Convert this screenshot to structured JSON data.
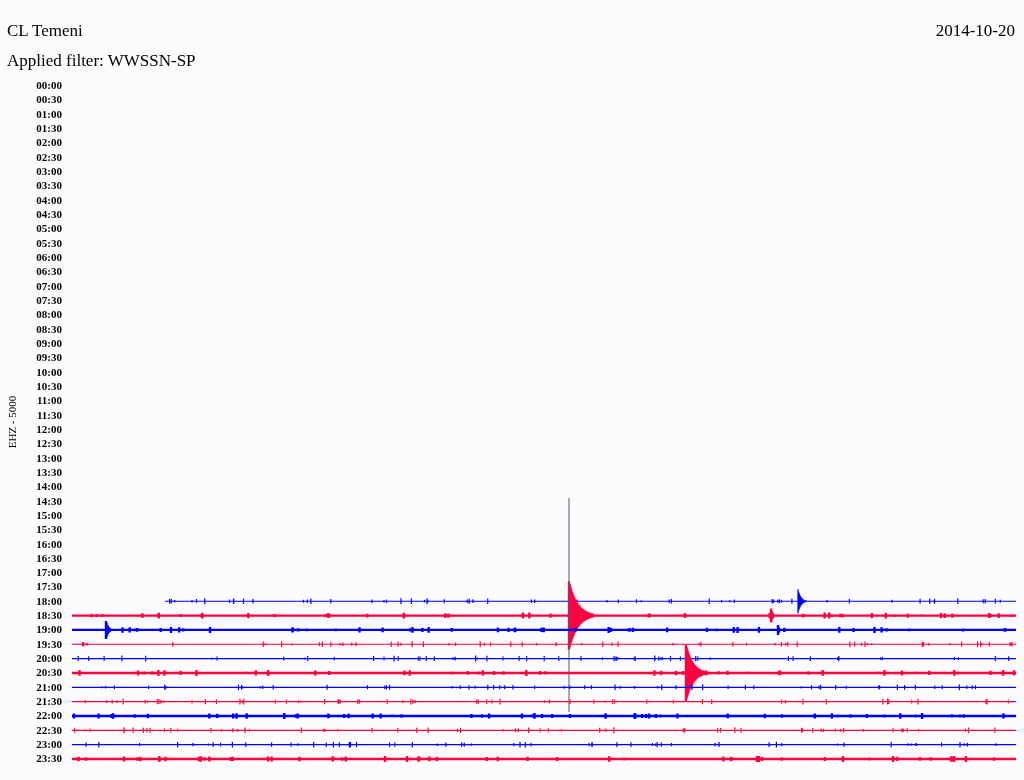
{
  "station": "CL Temeni",
  "date": "2014-10-20",
  "filter": "Applied filter: WWSSN-SP",
  "channel_label": "EHZ - 5000",
  "rows": [
    {
      "time": "00:00"
    },
    {
      "time": "00:30"
    },
    {
      "time": "01:00"
    },
    {
      "time": "01:30"
    },
    {
      "time": "02:00"
    },
    {
      "time": "02:30"
    },
    {
      "time": "03:00"
    },
    {
      "time": "03:30"
    },
    {
      "time": "04:00"
    },
    {
      "time": "04:30"
    },
    {
      "time": "05:00"
    },
    {
      "time": "05:30"
    },
    {
      "time": "06:00"
    },
    {
      "time": "06:30"
    },
    {
      "time": "07:00"
    },
    {
      "time": "07:30"
    },
    {
      "time": "08:00"
    },
    {
      "time": "08:30"
    },
    {
      "time": "09:00"
    },
    {
      "time": "09:30"
    },
    {
      "time": "10:00"
    },
    {
      "time": "10:30"
    },
    {
      "time": "11:00"
    },
    {
      "time": "11:30"
    },
    {
      "time": "12:00"
    },
    {
      "time": "12:30"
    },
    {
      "time": "13:00"
    },
    {
      "time": "13:30"
    },
    {
      "time": "14:00"
    },
    {
      "time": "14:30"
    },
    {
      "time": "15:00"
    },
    {
      "time": "15:30"
    },
    {
      "time": "16:00"
    },
    {
      "time": "16:30"
    },
    {
      "time": "17:00"
    },
    {
      "time": "17:30"
    },
    {
      "time": "18:00",
      "color": "#0000ff",
      "kind": "thin"
    },
    {
      "time": "18:30",
      "color": "#ff0040",
      "kind": "thick"
    },
    {
      "time": "19:00",
      "color": "#0000ff",
      "kind": "thick"
    },
    {
      "time": "19:30",
      "color": "#ff0040",
      "kind": "thin"
    },
    {
      "time": "20:00",
      "color": "#0000ff",
      "kind": "thin"
    },
    {
      "time": "20:30",
      "color": "#ff0040",
      "kind": "thick"
    },
    {
      "time": "21:00",
      "color": "#0000ff",
      "kind": "thin"
    },
    {
      "time": "21:30",
      "color": "#ff0040",
      "kind": "thin"
    },
    {
      "time": "22:00",
      "color": "#0000ff",
      "kind": "thick"
    },
    {
      "time": "22:30",
      "color": "#ff0040",
      "kind": "thin"
    },
    {
      "time": "23:00",
      "color": "#0000ff",
      "kind": "thin"
    },
    {
      "time": "23:30",
      "color": "#ff0040",
      "kind": "thick"
    }
  ]
}
